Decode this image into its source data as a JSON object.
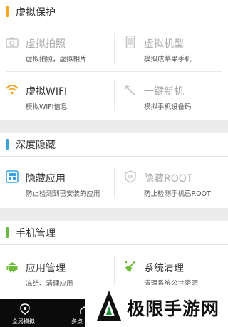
{
  "colors": {
    "orange_accent": "#f5a623",
    "blue_accent": "#3aa0e0",
    "green_accent": "#6cbb3c",
    "icon_gray": "#c8c8c8",
    "bottom_bar": "#0b0b0b"
  },
  "sections": [
    {
      "title": "虚拟保护",
      "items": [
        {
          "name": "虚拟拍照",
          "desc": "虚拟拍照，虚拟相片",
          "icon": "camera-icon",
          "enabled": false
        },
        {
          "name": "虚拟机型",
          "desc": "模拟成苹果手机",
          "icon": "phone-icon",
          "enabled": false
        },
        {
          "name": "虚拟WIFI",
          "desc": "模拟WIFI信息",
          "icon": "wifi-icon",
          "enabled": true
        },
        {
          "name": "一键新机",
          "desc": "模拟手机设备码",
          "icon": "magic-wand-icon",
          "enabled": false
        }
      ]
    },
    {
      "title": "深度隐藏",
      "items": [
        {
          "name": "隐藏应用",
          "desc": "防止检测到已安装的应用",
          "icon": "app-box-icon",
          "enabled": true
        },
        {
          "name": "隐藏ROOT",
          "desc": "防止检测手机已ROOT",
          "icon": "root-icon",
          "enabled": false
        }
      ]
    },
    {
      "title": "手机管理",
      "items": [
        {
          "name": "应用管理",
          "desc": "冻结、清理应用",
          "icon": "android-icon",
          "enabled": true
        },
        {
          "name": "系统清理",
          "desc": "清理系统公共资源",
          "icon": "broom-icon",
          "enabled": true
        }
      ]
    }
  ],
  "bottom_nav": [
    {
      "label": "全局模拟",
      "icon": "location-pin-icon"
    },
    {
      "label": "多点",
      "icon": "multi-point-icon"
    }
  ],
  "watermark": {
    "text": "极限手游网"
  }
}
